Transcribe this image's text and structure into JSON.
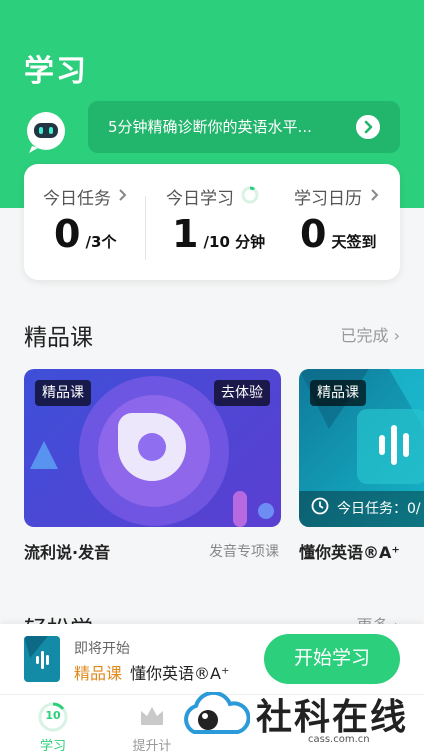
{
  "header": {
    "title": "学习",
    "bg_color": "#2ccf7c"
  },
  "banner": {
    "text": "5分钟精确诊断你的英语水平...",
    "mascot_icon": "robot-mascot-icon",
    "arrow_icon": "chevron-right-circle-icon"
  },
  "stats": {
    "today_task": {
      "label": "今日任务",
      "value": "0",
      "total": "/3个"
    },
    "today_study": {
      "label": "今日学习",
      "value": "1",
      "total": "/10 分钟"
    },
    "calendar": {
      "label": "学习日历",
      "value": "0",
      "unit": "天签到"
    }
  },
  "section_premium": {
    "title": "精品课",
    "link": "已完成",
    "courses": [
      {
        "tag": "精品课",
        "action": "去体验",
        "name": "流利说·发音",
        "subtitle": "发音专项课"
      },
      {
        "tag": "精品课",
        "overlay": "今日任务：0/",
        "name": "懂你英语®A⁺"
      }
    ]
  },
  "section_easy": {
    "title": "轻松学",
    "link": "更多"
  },
  "bottom_bar": {
    "label": "即将开始",
    "tag": "精品课",
    "course": "懂你英语®A⁺",
    "button": "开始学习"
  },
  "tabs": [
    {
      "label": "学习",
      "badge": "10",
      "active": true
    },
    {
      "label": "提升计"
    }
  ],
  "watermark": {
    "text": "社科在线",
    "sub": "cass.com.cn"
  },
  "colors": {
    "accent": "#2ccf7c",
    "orange": "#e08a1c"
  }
}
